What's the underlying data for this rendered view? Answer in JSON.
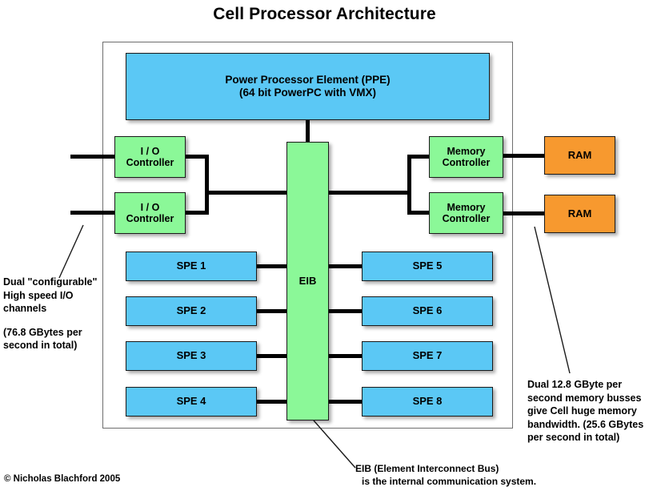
{
  "title": "Cell Processor Architecture",
  "colors": {
    "processing_blue": "#5bc8f5",
    "interconnect_green": "#8bf898",
    "memory_orange": "#f7992f",
    "wire_black": "#000000",
    "chip_border_gray": "#6e6e6e"
  },
  "blocks": {
    "ppe": {
      "line1": "Power Processor Element (PPE)",
      "line2": "(64 bit PowerPC with VMX)"
    },
    "io_controller_1": {
      "line1": "I / O",
      "line2": "Controller"
    },
    "io_controller_2": {
      "line1": "I / O",
      "line2": "Controller"
    },
    "memory_controller_1": {
      "line1": "Memory",
      "line2": "Controller"
    },
    "memory_controller_2": {
      "line1": "Memory",
      "line2": "Controller"
    },
    "ram_1": {
      "label": "RAM"
    },
    "ram_2": {
      "label": "RAM"
    },
    "eib": {
      "label": "EIB"
    }
  },
  "spes_left": [
    {
      "label": "SPE 1"
    },
    {
      "label": "SPE 2"
    },
    {
      "label": "SPE 3"
    },
    {
      "label": "SPE 4"
    }
  ],
  "spes_right": [
    {
      "label": "SPE 5"
    },
    {
      "label": "SPE 6"
    },
    {
      "label": "SPE 7"
    },
    {
      "label": "SPE 8"
    }
  ],
  "annotations": {
    "io_note": {
      "line1": "Dual \"configurable\"",
      "line2": "High speed I/O",
      "line3": "channels",
      "line4": "(76.8 GBytes per",
      "line5": "second in total)"
    },
    "memory_note": {
      "line1": "Dual 12.8 GByte per",
      "line2": "second memory busses",
      "line3": "give Cell huge memory",
      "line4": "bandwidth.  (25.6 GBytes",
      "line5": "per second in total)"
    },
    "eib_note": {
      "line1": "EIB (Element Interconnect Bus)",
      "line2": "is the internal communication system."
    }
  },
  "copyright": "© Nicholas Blachford 2005"
}
